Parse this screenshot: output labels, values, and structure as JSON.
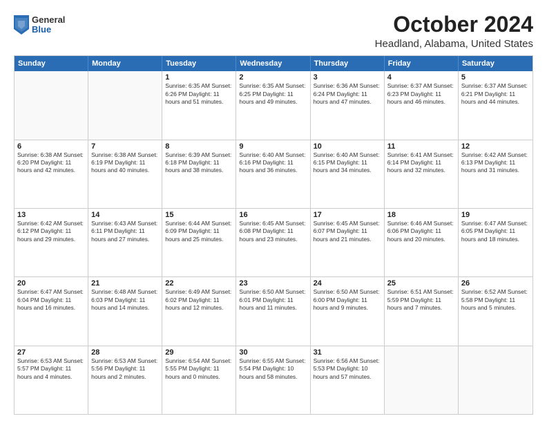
{
  "header": {
    "logo": {
      "general": "General",
      "blue": "Blue"
    },
    "month": "October 2024",
    "location": "Headland, Alabama, United States"
  },
  "days_header": [
    "Sunday",
    "Monday",
    "Tuesday",
    "Wednesday",
    "Thursday",
    "Friday",
    "Saturday"
  ],
  "weeks": [
    [
      {
        "day": "",
        "info": ""
      },
      {
        "day": "",
        "info": ""
      },
      {
        "day": "1",
        "info": "Sunrise: 6:35 AM\nSunset: 6:26 PM\nDaylight: 11 hours\nand 51 minutes."
      },
      {
        "day": "2",
        "info": "Sunrise: 6:35 AM\nSunset: 6:25 PM\nDaylight: 11 hours\nand 49 minutes."
      },
      {
        "day": "3",
        "info": "Sunrise: 6:36 AM\nSunset: 6:24 PM\nDaylight: 11 hours\nand 47 minutes."
      },
      {
        "day": "4",
        "info": "Sunrise: 6:37 AM\nSunset: 6:23 PM\nDaylight: 11 hours\nand 46 minutes."
      },
      {
        "day": "5",
        "info": "Sunrise: 6:37 AM\nSunset: 6:21 PM\nDaylight: 11 hours\nand 44 minutes."
      }
    ],
    [
      {
        "day": "6",
        "info": "Sunrise: 6:38 AM\nSunset: 6:20 PM\nDaylight: 11 hours\nand 42 minutes."
      },
      {
        "day": "7",
        "info": "Sunrise: 6:38 AM\nSunset: 6:19 PM\nDaylight: 11 hours\nand 40 minutes."
      },
      {
        "day": "8",
        "info": "Sunrise: 6:39 AM\nSunset: 6:18 PM\nDaylight: 11 hours\nand 38 minutes."
      },
      {
        "day": "9",
        "info": "Sunrise: 6:40 AM\nSunset: 6:16 PM\nDaylight: 11 hours\nand 36 minutes."
      },
      {
        "day": "10",
        "info": "Sunrise: 6:40 AM\nSunset: 6:15 PM\nDaylight: 11 hours\nand 34 minutes."
      },
      {
        "day": "11",
        "info": "Sunrise: 6:41 AM\nSunset: 6:14 PM\nDaylight: 11 hours\nand 32 minutes."
      },
      {
        "day": "12",
        "info": "Sunrise: 6:42 AM\nSunset: 6:13 PM\nDaylight: 11 hours\nand 31 minutes."
      }
    ],
    [
      {
        "day": "13",
        "info": "Sunrise: 6:42 AM\nSunset: 6:12 PM\nDaylight: 11 hours\nand 29 minutes."
      },
      {
        "day": "14",
        "info": "Sunrise: 6:43 AM\nSunset: 6:11 PM\nDaylight: 11 hours\nand 27 minutes."
      },
      {
        "day": "15",
        "info": "Sunrise: 6:44 AM\nSunset: 6:09 PM\nDaylight: 11 hours\nand 25 minutes."
      },
      {
        "day": "16",
        "info": "Sunrise: 6:45 AM\nSunset: 6:08 PM\nDaylight: 11 hours\nand 23 minutes."
      },
      {
        "day": "17",
        "info": "Sunrise: 6:45 AM\nSunset: 6:07 PM\nDaylight: 11 hours\nand 21 minutes."
      },
      {
        "day": "18",
        "info": "Sunrise: 6:46 AM\nSunset: 6:06 PM\nDaylight: 11 hours\nand 20 minutes."
      },
      {
        "day": "19",
        "info": "Sunrise: 6:47 AM\nSunset: 6:05 PM\nDaylight: 11 hours\nand 18 minutes."
      }
    ],
    [
      {
        "day": "20",
        "info": "Sunrise: 6:47 AM\nSunset: 6:04 PM\nDaylight: 11 hours\nand 16 minutes."
      },
      {
        "day": "21",
        "info": "Sunrise: 6:48 AM\nSunset: 6:03 PM\nDaylight: 11 hours\nand 14 minutes."
      },
      {
        "day": "22",
        "info": "Sunrise: 6:49 AM\nSunset: 6:02 PM\nDaylight: 11 hours\nand 12 minutes."
      },
      {
        "day": "23",
        "info": "Sunrise: 6:50 AM\nSunset: 6:01 PM\nDaylight: 11 hours\nand 11 minutes."
      },
      {
        "day": "24",
        "info": "Sunrise: 6:50 AM\nSunset: 6:00 PM\nDaylight: 11 hours\nand 9 minutes."
      },
      {
        "day": "25",
        "info": "Sunrise: 6:51 AM\nSunset: 5:59 PM\nDaylight: 11 hours\nand 7 minutes."
      },
      {
        "day": "26",
        "info": "Sunrise: 6:52 AM\nSunset: 5:58 PM\nDaylight: 11 hours\nand 5 minutes."
      }
    ],
    [
      {
        "day": "27",
        "info": "Sunrise: 6:53 AM\nSunset: 5:57 PM\nDaylight: 11 hours\nand 4 minutes."
      },
      {
        "day": "28",
        "info": "Sunrise: 6:53 AM\nSunset: 5:56 PM\nDaylight: 11 hours\nand 2 minutes."
      },
      {
        "day": "29",
        "info": "Sunrise: 6:54 AM\nSunset: 5:55 PM\nDaylight: 11 hours\nand 0 minutes."
      },
      {
        "day": "30",
        "info": "Sunrise: 6:55 AM\nSunset: 5:54 PM\nDaylight: 10 hours\nand 58 minutes."
      },
      {
        "day": "31",
        "info": "Sunrise: 6:56 AM\nSunset: 5:53 PM\nDaylight: 10 hours\nand 57 minutes."
      },
      {
        "day": "",
        "info": ""
      },
      {
        "day": "",
        "info": ""
      }
    ]
  ]
}
